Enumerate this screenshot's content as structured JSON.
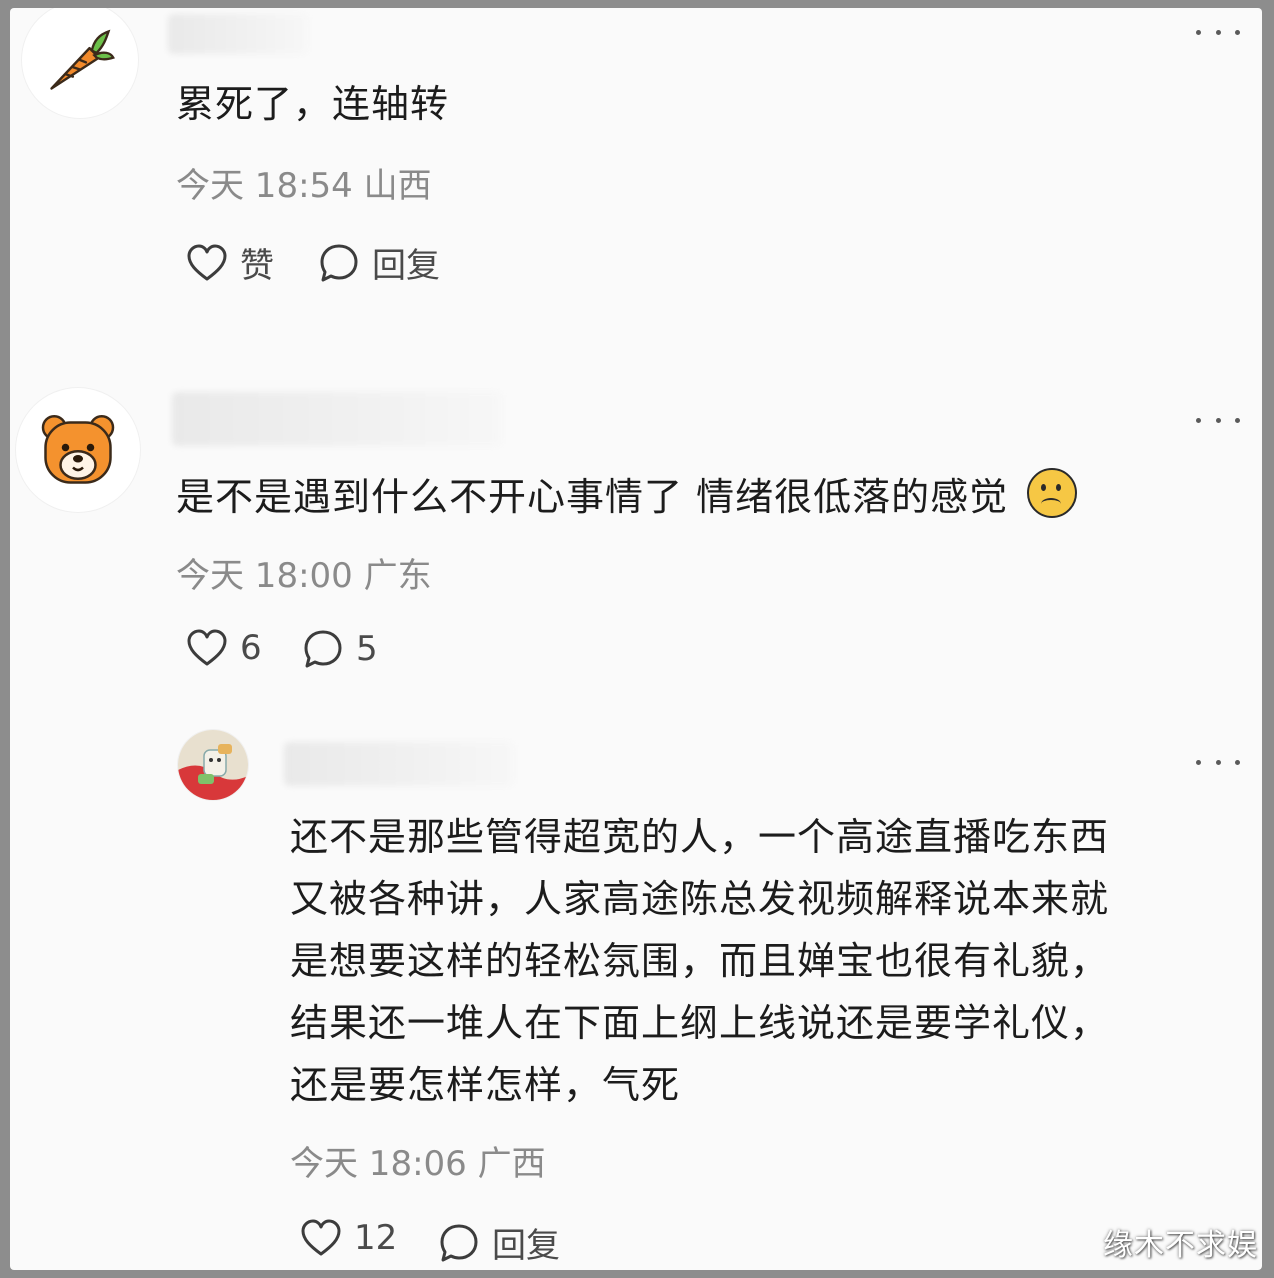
{
  "comments": [
    {
      "avatar_icon": "carrot-icon",
      "text": "累死了，连轴转",
      "meta": "今天 18:54 山西",
      "like_label": "赞",
      "reply_label": "回复"
    },
    {
      "avatar_icon": "bear-icon",
      "text": "是不是遇到什么不开心事情了 情绪很低落的感觉",
      "emoji": "☹",
      "meta": "今天 18:00 广东",
      "like_count": "6",
      "reply_count": "5"
    },
    {
      "avatar_icon": "user-photo-icon",
      "text_lines": [
        "还不是那些管得超宽的人，一个高途直播吃东西",
        "又被各种讲，人家高途陈总发视频解释说本来就",
        "是想要这样的轻松氛围，而且婵宝也很有礼貌，",
        "结果还一堆人在下面上纲上线说还是要学礼仪，",
        "还是要怎样怎样，气死"
      ],
      "meta": "今天 18:06 广西",
      "like_count": "12",
      "reply_label": "回复"
    }
  ],
  "watermark": "缘木不求娱"
}
